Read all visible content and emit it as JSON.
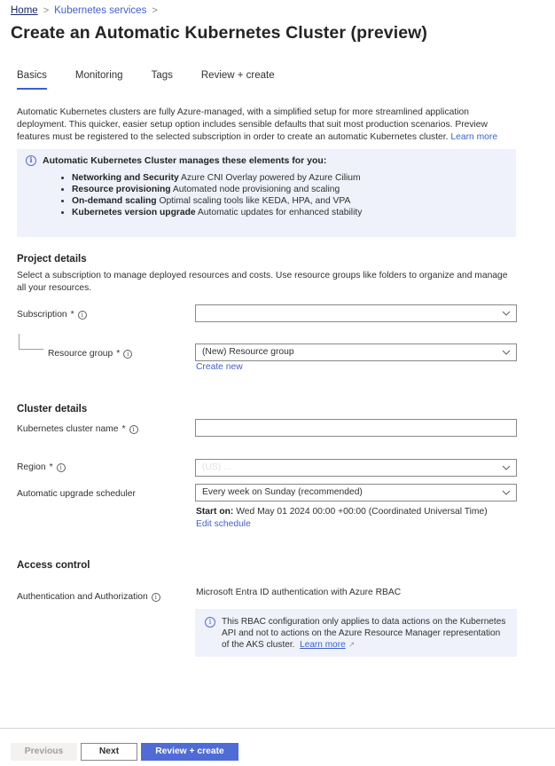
{
  "breadcrumb": {
    "items": [
      "Home",
      "Kubernetes services"
    ],
    "separator": ">"
  },
  "page": {
    "title": "Create an Automatic Kubernetes Cluster (preview)",
    "more_label": "..."
  },
  "tabs": [
    {
      "label": "Basics",
      "active": true
    },
    {
      "label": "Monitoring",
      "active": false
    },
    {
      "label": "Tags",
      "active": false
    },
    {
      "label": "Review + create",
      "active": false
    }
  ],
  "intro": {
    "text": "Automatic Kubernetes clusters are fully Azure-managed, with a simplified setup for more streamlined application deployment. This quicker, easier setup option includes sensible defaults that suit most production scenarios. Preview features must be registered to the selected subscription in order to create an automatic Kubernetes cluster.",
    "link": "Learn more"
  },
  "info_box": {
    "icon": "info-icon",
    "heading": "Automatic Kubernetes Cluster manages these elements for you:",
    "items": [
      {
        "title": "Networking and Security",
        "text": "Azure CNI Overlay powered by Azure Cilium"
      },
      {
        "title": "Resource provisioning",
        "text": "Automated node provisioning and scaling"
      },
      {
        "title": "On-demand scaling",
        "text": "Optimal scaling tools like KEDA, HPA, and VPA"
      },
      {
        "title": "Kubernetes version upgrade",
        "text": "Automatic updates for enhanced stability"
      }
    ]
  },
  "project_details": {
    "title": "Project details",
    "description": "Select a subscription to manage deployed resources and costs. Use resource groups like folders to organize and manage all your resources.",
    "subscription": {
      "label": "Subscription",
      "required": "*",
      "value": ""
    },
    "resource_group": {
      "label": "Resource group",
      "required": "*",
      "value": "(New) Resource group",
      "create_new": "Create new"
    }
  },
  "cluster_details": {
    "title": "Cluster details",
    "cluster_name": {
      "label": "Kubernetes cluster name",
      "required": "*",
      "value": ""
    },
    "region": {
      "label": "Region",
      "required": "*",
      "value": "(US) ..."
    },
    "upgrade_scheduler": {
      "label": "Automatic upgrade scheduler",
      "value": "Every week on Sunday (recommended)",
      "start_on_label": "Start on:",
      "start_on_value": "Wed May 01 2024 00:00 +00:00 (Coordinated Universal Time)",
      "edit_link": "Edit schedule"
    }
  },
  "access_control": {
    "title": "Access control",
    "auth": {
      "label": "Authentication and Authorization",
      "value": "Microsoft Entra ID authentication with Azure RBAC"
    },
    "rbac_note": {
      "text": "This RBAC configuration only applies to data actions on the Kubernetes API and not to actions on the Azure Resource Manager representation of the AKS cluster.",
      "link": "Learn more"
    }
  },
  "footer": {
    "previous": "Previous",
    "next": "Next",
    "review_create": "Review + create"
  },
  "colors": {
    "accent": "#4f6bd6",
    "link": "#4461c9",
    "info_bg": "#f0f2fb"
  }
}
